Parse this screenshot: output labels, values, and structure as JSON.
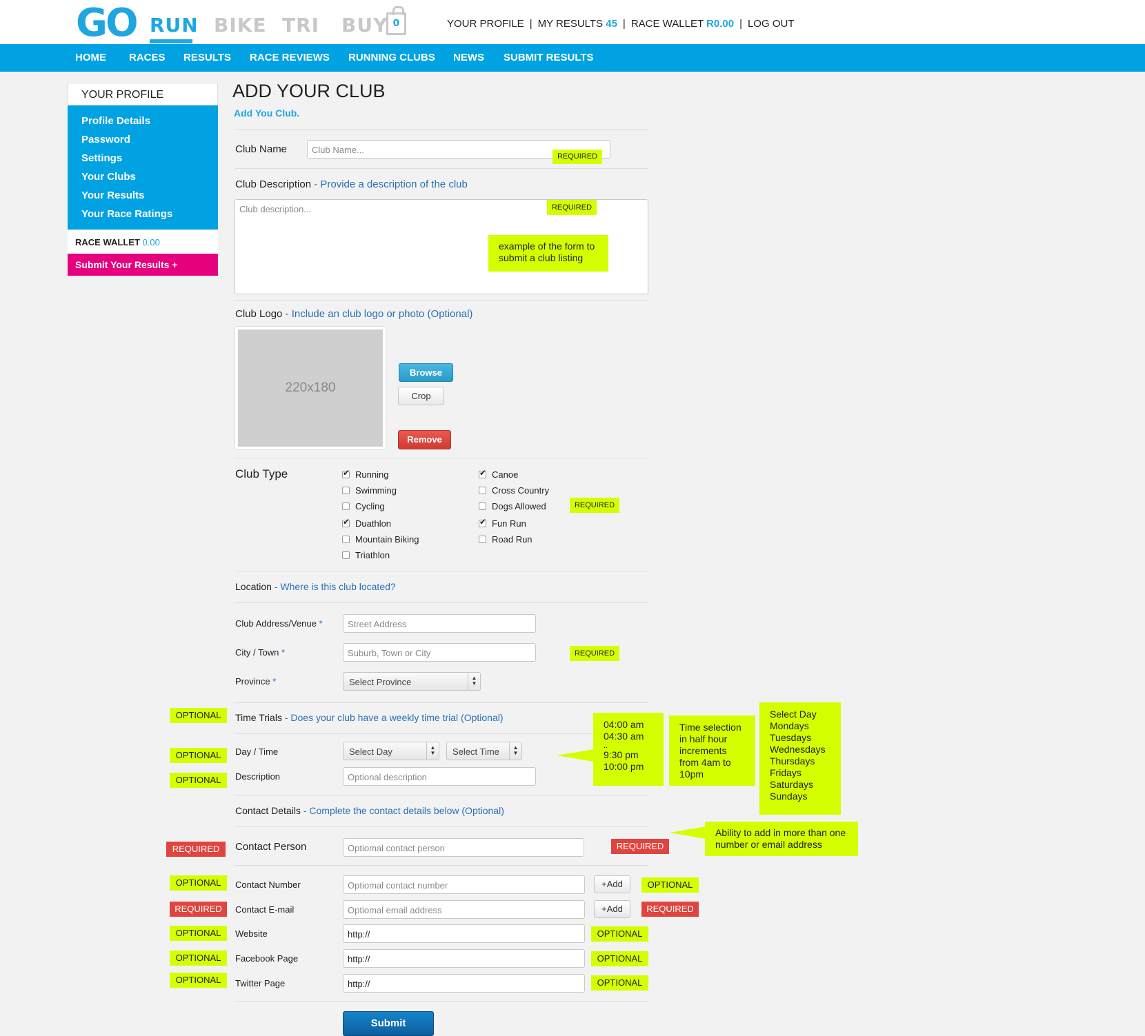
{
  "header": {
    "logo": "GO",
    "sports": [
      "RUN",
      "BIKE",
      "TRI",
      "BUY"
    ],
    "cart_count": "0",
    "links": {
      "profile": "YOUR PROFILE",
      "results": "MY RESULTS",
      "results_count": "45",
      "wallet": "RACE WALLET",
      "wallet_amount": "R0.00",
      "logout": "LOG OUT",
      "separator": "|"
    },
    "nav": [
      "HOME",
      "RACES",
      "RESULTS",
      "RACE REVIEWS",
      "RUNNING CLUBS",
      "NEWS",
      "SUBMIT RESULTS"
    ]
  },
  "sidebar": {
    "title": "YOUR PROFILE",
    "items": [
      "Profile Details",
      "Password",
      "Settings",
      "Your Clubs",
      "Your Results",
      "Your Race Ratings"
    ],
    "wallet_label": "RACE WALLET",
    "wallet_value": "0.00",
    "submit": "Submit Your Results +"
  },
  "main": {
    "title": "ADD YOUR CLUB",
    "subtitle": "Add You Club.",
    "club_name": {
      "label": "Club Name",
      "placeholder": "Club Name..."
    },
    "club_desc": {
      "label": "Club Description",
      "hint": "- Provide a description of the club",
      "placeholder": "Club description..."
    },
    "club_logo": {
      "label": "Club Logo",
      "hint": "- Include an club logo or photo (Optional)",
      "placeholder_size": "220x180"
    },
    "buttons": {
      "browse": "Browse",
      "crop": "Crop",
      "remove": "Remove",
      "submit": "Submit",
      "add": "+Add"
    },
    "club_type": {
      "label": "Club Type",
      "col1": [
        {
          "label": "Running",
          "checked": true
        },
        {
          "label": "Swimming",
          "checked": false
        },
        {
          "label": "Cycling",
          "checked": false
        },
        {
          "label": "Duathlon",
          "checked": true
        },
        {
          "label": "Mountain Biking",
          "checked": false
        },
        {
          "label": "Triathlon",
          "checked": false
        }
      ],
      "col2": [
        {
          "label": "Canoe",
          "checked": true
        },
        {
          "label": "Cross Country",
          "checked": false
        },
        {
          "label": "Dogs Allowed",
          "checked": false
        },
        {
          "label": "Fun Run",
          "checked": true
        },
        {
          "label": "Road Run",
          "checked": false
        }
      ]
    },
    "location": {
      "label": "Location",
      "hint": "- Where is this club located?",
      "address_label": "Club Address/Venue",
      "address_placeholder": "Street Address",
      "city_label": "City / Town",
      "city_placeholder": "Suburb, Town or City",
      "province_label": "Province",
      "province_select": "Select Province",
      "asterisk": "*"
    },
    "time_trials": {
      "label": "Time Trials",
      "hint": "- Does your club have a weekly time trial (Optional)",
      "daytime_label": "Day / Time",
      "select_day": "Select Day",
      "select_time": "Select Time",
      "desc_label": "Description",
      "desc_placeholder": "Optional description"
    },
    "contact": {
      "label": "Contact Details",
      "hint": "- Complete the contact details below (Optional)",
      "person_label": "Contact Person",
      "person_placeholder": "Optiomal contact person",
      "number_label": "Contact Number",
      "number_placeholder": "Optiomal contact number",
      "email_label": "Contact E-mail",
      "email_placeholder": "Optiomal email address",
      "website_label": "Website",
      "facebook_label": "Facebook Page",
      "twitter_label": "Twitter Page",
      "url_value": "http://"
    }
  },
  "badges": {
    "required": "REQUIRED",
    "optional": "OPTIONAL"
  },
  "notes": {
    "form_example": "example of the form to submit a club listing",
    "times": [
      "04:00 am",
      "04:30 am",
      "..",
      "9:30 pm",
      "10:00 pm"
    ],
    "time_selection": "Time selection in half hour increments from 4am to 10pm",
    "days": [
      "Select Day",
      "Mondays",
      "Tuesdays",
      "Wednesdays",
      "Thursdays",
      "Fridays",
      "Saturdays",
      "Sundays"
    ],
    "multi_contact": "Ability to add in more than one number or email address"
  },
  "colors": {
    "brand_blue": "#00a2e2",
    "magenta": "#e6007e",
    "annotation_green": "#d4ff00",
    "annotation_red": "#e0443e"
  }
}
